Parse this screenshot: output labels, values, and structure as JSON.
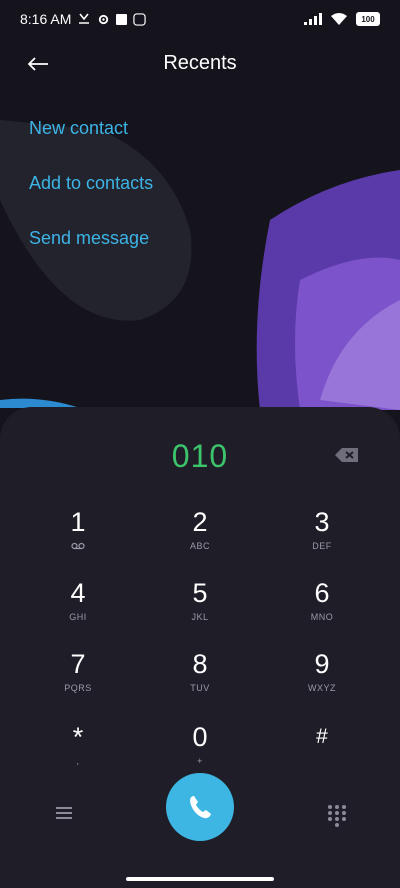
{
  "status": {
    "time": "8:16 AM",
    "battery": "100"
  },
  "header": {
    "title": "Recents"
  },
  "actions": [
    "New contact",
    "Add to contacts",
    "Send message"
  ],
  "dialer": {
    "number": "010",
    "keys": [
      {
        "digit": "1",
        "letters": ""
      },
      {
        "digit": "2",
        "letters": "ABC"
      },
      {
        "digit": "3",
        "letters": "DEF"
      },
      {
        "digit": "4",
        "letters": "GHI"
      },
      {
        "digit": "5",
        "letters": "JKL"
      },
      {
        "digit": "6",
        "letters": "MNO"
      },
      {
        "digit": "7",
        "letters": "PQRS"
      },
      {
        "digit": "8",
        "letters": "TUV"
      },
      {
        "digit": "9",
        "letters": "WXYZ"
      },
      {
        "digit": "*",
        "letters": ","
      },
      {
        "digit": "0",
        "letters": "+"
      },
      {
        "digit": "#",
        "letters": ""
      }
    ]
  },
  "colors": {
    "accent": "#3cb4e6",
    "number": "#3cc46a",
    "call": "#3db6e3",
    "panel": "#1f1e28"
  }
}
